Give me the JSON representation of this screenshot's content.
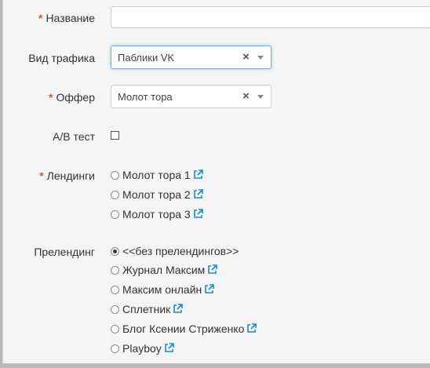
{
  "form": {
    "name": {
      "label": "Название",
      "required_mark": "*",
      "value": ""
    },
    "traffic_type": {
      "label": "Вид трафика",
      "value": "Паблики VK",
      "clear_glyph": "×"
    },
    "offer": {
      "label": "Оффер",
      "required_mark": "*",
      "value": "Молот тора",
      "clear_glyph": "×"
    },
    "ab_test": {
      "label": "A/B тест",
      "checked": false
    },
    "landings": {
      "label": "Лендинги",
      "required_mark": "*",
      "options": [
        {
          "label": "Молот тора 1",
          "checked": false
        },
        {
          "label": "Молот тора 2",
          "checked": false
        },
        {
          "label": "Молот тора 3",
          "checked": false
        }
      ]
    },
    "prelanding": {
      "label": "Прелендинг",
      "options": [
        {
          "label": "<<без прелендингов>>",
          "checked": true
        },
        {
          "label": "Журнал Максим",
          "checked": false
        },
        {
          "label": "Максим онлайн",
          "checked": false
        },
        {
          "label": "Сплетник",
          "checked": false
        },
        {
          "label": "Блог Ксении Стриженко",
          "checked": false
        },
        {
          "label": "Playboy",
          "checked": false
        }
      ]
    }
  },
  "colors": {
    "required": "#d9534f",
    "link_icon": "#1a8bd4",
    "focus": "#66afe9"
  }
}
